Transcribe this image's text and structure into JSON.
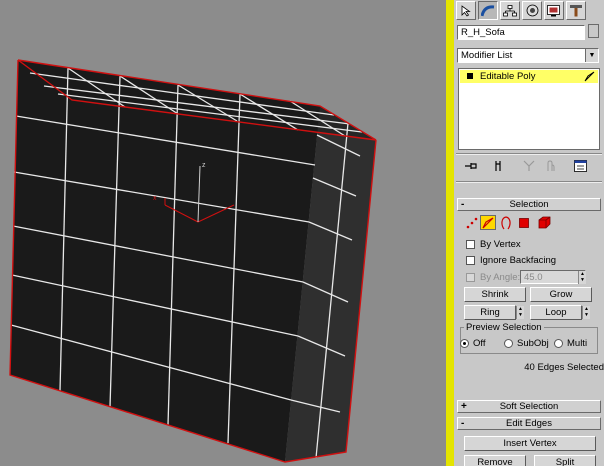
{
  "viewport": {
    "gizmo_axes": [
      "x",
      "y",
      "z"
    ]
  },
  "panel": {
    "tabs": [
      {
        "name": "create-tab",
        "icon": "pointer-icon"
      },
      {
        "name": "modify-tab",
        "icon": "arc-icon"
      },
      {
        "name": "hierarchy-tab",
        "icon": "hierarchy-icon"
      },
      {
        "name": "motion-tab",
        "icon": "motion-icon"
      },
      {
        "name": "display-tab",
        "icon": "display-icon"
      },
      {
        "name": "utilities-tab",
        "icon": "hammer-icon"
      }
    ],
    "object_name": "R_H_Sofa",
    "modifier_list": "Modifier List",
    "stack": [
      {
        "label": "Editable Poly",
        "selected": true
      }
    ],
    "stack_tools": [
      "pin-stack-icon",
      "show-end-result-icon",
      "make-unique-icon",
      "remove-modifier-icon",
      "configure-modifier-sets-icon"
    ],
    "selection": {
      "title": "Selection",
      "expanded_sign": "-",
      "levels": [
        "vertex-icon",
        "edge-icon",
        "border-icon",
        "polygon-icon",
        "element-icon"
      ],
      "by_vertex": "By Vertex",
      "ignore_backfacing": "Ignore Backfacing",
      "by_angle": "By Angle:",
      "angle_value": "45.0",
      "shrink": "Shrink",
      "grow": "Grow",
      "ring": "Ring",
      "loop": "Loop",
      "preview_title": "Preview Selection",
      "preview_options": [
        "Off",
        "SubObj",
        "Multi"
      ],
      "preview_selected": "Off",
      "info": "40 Edges Selected"
    },
    "soft_selection": {
      "title": "Soft Selection",
      "collapsed_sign": "+"
    },
    "edit_edges": {
      "title": "Edit Edges",
      "expanded_sign": "-",
      "insert_vertex": "Insert Vertex",
      "remove": "Remove",
      "split": "Split"
    }
  },
  "colors": {
    "accent_yellow": "#e4e400",
    "stack_highlight": "#ffff66",
    "panel_bg": "#c8c8c8",
    "viewport_bg": "#8c8c8c",
    "mesh_face": "#1b1b1b",
    "mesh_side": "#2e2e2e",
    "wire": "#e8e8e8",
    "edge_selected": "#d01010"
  }
}
